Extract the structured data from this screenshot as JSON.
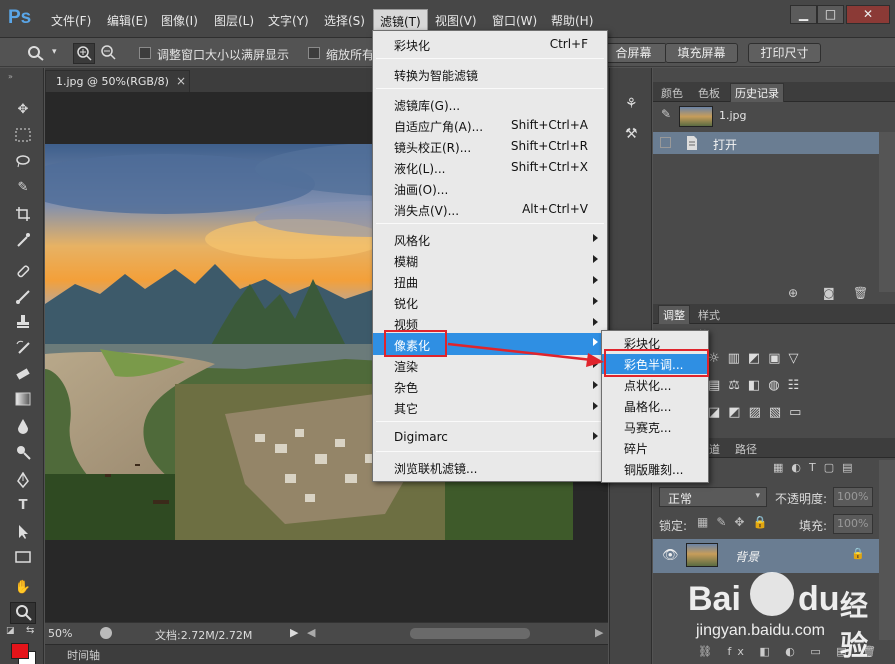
{
  "app": {
    "logo": "Ps"
  },
  "menubar": {
    "items": [
      "文件(F)",
      "编辑(E)",
      "图像(I)",
      "图层(L)",
      "文字(Y)",
      "选择(S)",
      "滤镜(T)",
      "视图(V)",
      "窗口(W)",
      "帮助(H)"
    ],
    "open_item": "滤镜(T)",
    "window_buttons": [
      "▁",
      "□",
      "✕"
    ]
  },
  "options": {
    "resize_windows_label": "调整窗口大小以满屏显示",
    "zoom_all_label": "缩放所有",
    "fit_screen_btn": "合屏幕",
    "fill_screen_btn": "填充屏幕",
    "print_size_btn": "打印尺寸"
  },
  "document": {
    "tab_title": "1.jpg @ 50%(RGB/8)",
    "tab_close": "×",
    "zoom": "50%",
    "doc_size": "文档:2.72M/2.72M",
    "timeline_label": "时间轴"
  },
  "filter_menu": {
    "items": [
      {
        "label": "彩块化",
        "shortcut": "Ctrl+F"
      },
      {
        "label": "转换为智能滤镜",
        "shortcut": ""
      },
      {
        "label": "滤镜库(G)...",
        "shortcut": ""
      },
      {
        "label": "自适应广角(A)...",
        "shortcut": "Shift+Ctrl+A"
      },
      {
        "label": "镜头校正(R)...",
        "shortcut": "Shift+Ctrl+R"
      },
      {
        "label": "液化(L)...",
        "shortcut": "Shift+Ctrl+X"
      },
      {
        "label": "油画(O)...",
        "shortcut": ""
      },
      {
        "label": "消失点(V)...",
        "shortcut": "Alt+Ctrl+V"
      },
      {
        "label": "风格化",
        "shortcut": ""
      },
      {
        "label": "模糊",
        "shortcut": ""
      },
      {
        "label": "扭曲",
        "shortcut": ""
      },
      {
        "label": "锐化",
        "shortcut": ""
      },
      {
        "label": "视频",
        "shortcut": ""
      },
      {
        "label": "像素化",
        "shortcut": ""
      },
      {
        "label": "渲染",
        "shortcut": ""
      },
      {
        "label": "杂色",
        "shortcut": ""
      },
      {
        "label": "其它",
        "shortcut": ""
      },
      {
        "label": "Digimarc",
        "shortcut": ""
      },
      {
        "label": "浏览联机滤镜...",
        "shortcut": ""
      }
    ],
    "highlighted": "像素化"
  },
  "pixelate_submenu": {
    "items": [
      "彩块化",
      "彩色半调...",
      "点状化...",
      "晶格化...",
      "马赛克...",
      "碎片",
      "铜版雕刻..."
    ],
    "highlighted": "彩色半调..."
  },
  "history_panel": {
    "tabs": [
      "颜色",
      "色板",
      "历史记录"
    ],
    "active_tab": "历史记录",
    "snapshot_name": "1.jpg",
    "states": [
      "打开"
    ]
  },
  "adjustments_panel": {
    "tabs": [
      "调整",
      "样式"
    ],
    "active_tab": "调整",
    "title_fragment": "整"
  },
  "layers_panel": {
    "tabs": [
      "通道",
      "路径"
    ],
    "kind_fragment": "型",
    "blend_mode": "正常",
    "opacity_label": "不透明度:",
    "opacity_value": "100%",
    "lock_label": "锁定:",
    "fill_label": "填充:",
    "fill_value": "100%",
    "layer_name": "背景",
    "footer_icons": "⛓ fx ◧ ◐ ▭ ▤ 🗑"
  },
  "watermark": {
    "brand": "Bai",
    "brand_mid": "du",
    "brand_cn": "经验",
    "url": "jingyan.baidu.com"
  },
  "colors": {
    "highlight": "#2f8fe3",
    "annotation_red": "#e0242c",
    "foreground": "#e5141a",
    "background": "#ffffff"
  }
}
